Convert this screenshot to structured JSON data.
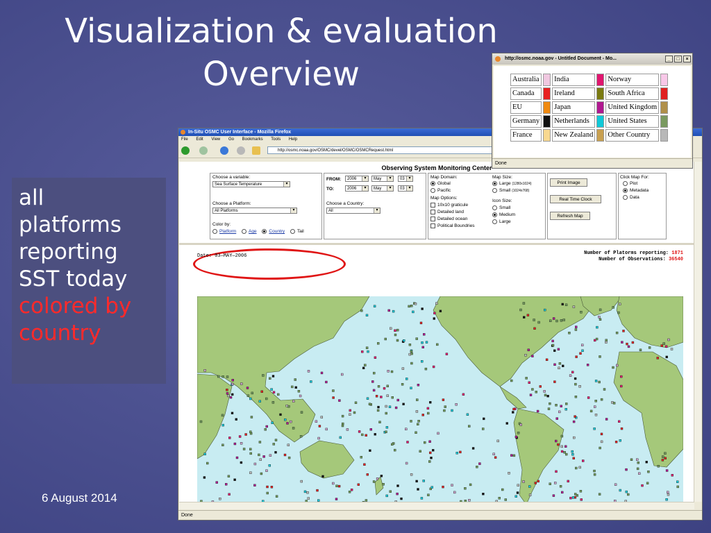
{
  "slide": {
    "title_line1": "Visualization & evaluation",
    "title_line2": "Overview",
    "date": "6 August 2014",
    "caption_white": [
      "all",
      "platforms",
      "reporting",
      "SST today"
    ],
    "caption_red": [
      "colored by",
      "country"
    ],
    "caption_red_color": "#ff2a2a"
  },
  "browser": {
    "window_title": "In-Situ OSMC User Interface - Mozilla Firefox",
    "menu": [
      "File",
      "Edit",
      "View",
      "Go",
      "Bookmarks",
      "Tools",
      "Help"
    ],
    "url": "http://osmc.noaa.gov/OSMC/devel/OSMC/OSMCRequest.html",
    "status": "Done"
  },
  "osmc": {
    "page_title": "Observing System Monitoring Center",
    "variable": {
      "label": "Choose a variable:",
      "value": "Sea Surface Temperature"
    },
    "platform": {
      "label": "Choose a Platform:",
      "value": "All Platforms"
    },
    "color_by": {
      "label": "Color by:",
      "options": [
        "Platform",
        "Age",
        "Country",
        "Tail"
      ],
      "selected": "Country"
    },
    "from": {
      "label": "FROM:",
      "year": "2006",
      "month": "May",
      "day": "03"
    },
    "to": {
      "label": "TO:",
      "year": "2006",
      "month": "May",
      "day": "03"
    },
    "country": {
      "label": "Choose a Country:",
      "value": "All"
    },
    "map_domain": {
      "label": "Map Domain:",
      "options": [
        "Global",
        "Pacific"
      ],
      "selected": "Global"
    },
    "map_options": {
      "label": "Map Options:",
      "items": [
        "10x10 graticule",
        "Detailed land",
        "Detailed ocean",
        "Political Boundries"
      ]
    },
    "map_size": {
      "label": "Map Size:",
      "large": "Large",
      "large_dim": "(1280x1024)",
      "small": "Small",
      "small_dim": "(1024x768)",
      "selected": "Large"
    },
    "icon_size": {
      "label": "Icon Size:",
      "options": [
        "Small",
        "Medium",
        "Large"
      ],
      "selected": "Medium"
    },
    "buttons": {
      "print": "Print Image",
      "realtime": "Real Time Clock",
      "refresh": "Refresh Map"
    },
    "click_map": {
      "label": "Click Map For:",
      "options": [
        "Plot",
        "Metadata",
        "Data"
      ],
      "selected": "Metadata"
    },
    "date_text": "Date: 03—MAY—2006",
    "platforms_label": "Number of Platorms reporting:",
    "platforms_value": "1871",
    "obs_label": "Number of Observations:",
    "obs_value": "36540",
    "highlight_color": "#e01515"
  },
  "popup": {
    "title": "http://osmc.noaa.gov - Untitled Document - Mo...",
    "status": "Done",
    "countries": [
      [
        {
          "name": "Australia",
          "color": "#f0c8e0"
        },
        {
          "name": "India",
          "color": "#e0156e"
        },
        {
          "name": "Norway",
          "color": "#f8c8e8"
        }
      ],
      [
        {
          "name": "Canada",
          "color": "#e82020"
        },
        {
          "name": "Ireland",
          "color": "#7a7a10"
        },
        {
          "name": "South Africa",
          "color": "#e02020"
        }
      ],
      [
        {
          "name": "EU",
          "color": "#f08a10"
        },
        {
          "name": "Japan",
          "color": "#b01890"
        },
        {
          "name": "United Kingdom",
          "color": "#b0904a"
        }
      ],
      [
        {
          "name": "Germany",
          "color": "#101010"
        },
        {
          "name": "Netherlands",
          "color": "#10c8d8"
        },
        {
          "name": "United States",
          "color": "#7a9a60"
        }
      ],
      [
        {
          "name": "France",
          "color": "#f8d890"
        },
        {
          "name": "New Zealand",
          "color": "#c8a050"
        },
        {
          "name": "Other Country",
          "color": "#b8b8b8"
        }
      ]
    ]
  }
}
